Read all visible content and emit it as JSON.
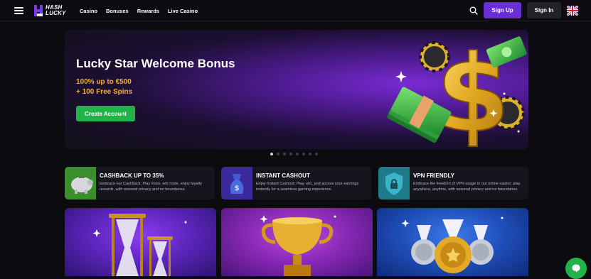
{
  "header": {
    "logo": "HASH LUCKY",
    "nav": [
      "Casino",
      "Bonuses",
      "Rewards",
      "Live Casino"
    ],
    "signup_label": "Sign Up",
    "signin_label": "Sign In"
  },
  "hero": {
    "title": "Lucky Star Welcome Bonus",
    "line1": "100% up to €500",
    "line2": "+ 100 Free Spins",
    "cta_label": "Create Account",
    "slides_count": 8,
    "active_slide": 1
  },
  "features": [
    {
      "title": "CASHBACK UP TO 35%",
      "text": "Embrace our Cashback: Play more, win more, enjoy loyalty rewards, with assured privacy and no boundaries."
    },
    {
      "title": "INSTANT CASHOUT",
      "text": "Enjoy Instant Cashout: Play, win, and access your earnings instantly for a seamless gaming experience."
    },
    {
      "title": "VPN FRIENDLY",
      "text": "Embrace the freedom of VPN usage in our online casino: play anywhere, anytime, with assured privacy and no boundaries."
    }
  ],
  "colors": {
    "accent_purple": "#6a2ed6",
    "cta_green": "#22b24a",
    "bonus_gold": "#f2b227"
  }
}
